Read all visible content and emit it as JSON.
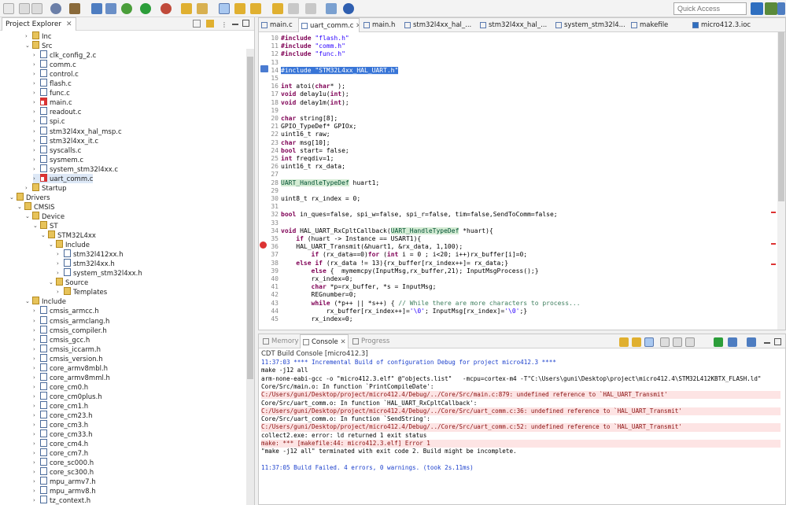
{
  "toolbar": {
    "quick_access_placeholder": "Quick Access",
    "colors": {
      "run": "#2c9e3a",
      "debug": "#4e7dc1",
      "build": "#6b6b6b",
      "warn": "#e0b030",
      "error": "#d33"
    }
  },
  "explorer": {
    "title": "Project Explorer",
    "close": "✕",
    "tree": [
      {
        "label": "Inc",
        "depth": 3,
        "kind": "folder",
        "tw": "›"
      },
      {
        "label": "Src",
        "depth": 3,
        "kind": "folder",
        "tw": "⌄"
      },
      {
        "label": "clk_config_2.c",
        "depth": 4,
        "kind": "c",
        "tw": "›"
      },
      {
        "label": "comm.c",
        "depth": 4,
        "kind": "c",
        "tw": "›"
      },
      {
        "label": "control.c",
        "depth": 4,
        "kind": "c",
        "tw": "›"
      },
      {
        "label": "flash.c",
        "depth": 4,
        "kind": "c",
        "tw": "›"
      },
      {
        "label": "func.c",
        "depth": 4,
        "kind": "c",
        "tw": "›"
      },
      {
        "label": "main.c",
        "depth": 4,
        "kind": "err",
        "tw": "›"
      },
      {
        "label": "readout.c",
        "depth": 4,
        "kind": "c",
        "tw": "›"
      },
      {
        "label": "spi.c",
        "depth": 4,
        "kind": "c",
        "tw": "›"
      },
      {
        "label": "stm32l4xx_hal_msp.c",
        "depth": 4,
        "kind": "c",
        "tw": "›"
      },
      {
        "label": "stm32l4xx_it.c",
        "depth": 4,
        "kind": "c",
        "tw": "›"
      },
      {
        "label": "syscalls.c",
        "depth": 4,
        "kind": "c",
        "tw": "›"
      },
      {
        "label": "sysmem.c",
        "depth": 4,
        "kind": "c",
        "tw": "›"
      },
      {
        "label": "system_stm32l4xx.c",
        "depth": 4,
        "kind": "c",
        "tw": "›"
      },
      {
        "label": "uart_comm.c",
        "depth": 4,
        "kind": "err",
        "tw": "›",
        "selected": true
      },
      {
        "label": "Startup",
        "depth": 3,
        "kind": "folder",
        "tw": "›"
      },
      {
        "label": "Drivers",
        "depth": 1,
        "kind": "folder",
        "tw": "⌄"
      },
      {
        "label": "CMSIS",
        "depth": 2,
        "kind": "folder",
        "tw": "⌄"
      },
      {
        "label": "Device",
        "depth": 3,
        "kind": "folder",
        "tw": "⌄"
      },
      {
        "label": "ST",
        "depth": 4,
        "kind": "folder",
        "tw": "⌄"
      },
      {
        "label": "STM32L4xx",
        "depth": 5,
        "kind": "folder",
        "tw": "⌄"
      },
      {
        "label": "Include",
        "depth": 6,
        "kind": "folder",
        "tw": "⌄"
      },
      {
        "label": "stm32l412xx.h",
        "depth": 7,
        "kind": "h",
        "tw": "›"
      },
      {
        "label": "stm32l4xx.h",
        "depth": 7,
        "kind": "h",
        "tw": "›"
      },
      {
        "label": "system_stm32l4xx.h",
        "depth": 7,
        "kind": "h",
        "tw": "›"
      },
      {
        "label": "Source",
        "depth": 6,
        "kind": "folder",
        "tw": "⌄"
      },
      {
        "label": "Templates",
        "depth": 7,
        "kind": "folder",
        "tw": "›"
      },
      {
        "label": "Include",
        "depth": 3,
        "kind": "folder",
        "tw": "⌄"
      },
      {
        "label": "cmsis_armcc.h",
        "depth": 4,
        "kind": "h",
        "tw": "›"
      },
      {
        "label": "cmsis_armclang.h",
        "depth": 4,
        "kind": "h",
        "tw": "›"
      },
      {
        "label": "cmsis_compiler.h",
        "depth": 4,
        "kind": "h",
        "tw": "›"
      },
      {
        "label": "cmsis_gcc.h",
        "depth": 4,
        "kind": "h",
        "tw": "›"
      },
      {
        "label": "cmsis_iccarm.h",
        "depth": 4,
        "kind": "h",
        "tw": "›"
      },
      {
        "label": "cmsis_version.h",
        "depth": 4,
        "kind": "h",
        "tw": "›"
      },
      {
        "label": "core_armv8mbl.h",
        "depth": 4,
        "kind": "h",
        "tw": "›"
      },
      {
        "label": "core_armv8mml.h",
        "depth": 4,
        "kind": "h",
        "tw": "›"
      },
      {
        "label": "core_cm0.h",
        "depth": 4,
        "kind": "h",
        "tw": "›"
      },
      {
        "label": "core_cm0plus.h",
        "depth": 4,
        "kind": "h",
        "tw": "›"
      },
      {
        "label": "core_cm1.h",
        "depth": 4,
        "kind": "h",
        "tw": "›"
      },
      {
        "label": "core_cm23.h",
        "depth": 4,
        "kind": "h",
        "tw": "›"
      },
      {
        "label": "core_cm3.h",
        "depth": 4,
        "kind": "h",
        "tw": "›"
      },
      {
        "label": "core_cm33.h",
        "depth": 4,
        "kind": "h",
        "tw": "›"
      },
      {
        "label": "core_cm4.h",
        "depth": 4,
        "kind": "h",
        "tw": "›"
      },
      {
        "label": "core_cm7.h",
        "depth": 4,
        "kind": "h",
        "tw": "›"
      },
      {
        "label": "core_sc000.h",
        "depth": 4,
        "kind": "h",
        "tw": "›"
      },
      {
        "label": "core_sc300.h",
        "depth": 4,
        "kind": "h",
        "tw": "›"
      },
      {
        "label": "mpu_armv7.h",
        "depth": 4,
        "kind": "h",
        "tw": "›"
      },
      {
        "label": "mpu_armv8.h",
        "depth": 4,
        "kind": "h",
        "tw": "›"
      },
      {
        "label": "tz_context.h",
        "depth": 4,
        "kind": "h",
        "tw": "›"
      }
    ]
  },
  "editor": {
    "tabs": [
      {
        "label": "main.c"
      },
      {
        "label": "uart_comm.c",
        "active": true,
        "close": "✕"
      },
      {
        "label": "main.h"
      },
      {
        "label": "stm32l4xx_hal_..."
      },
      {
        "label": "stm32l4xx_hal_..."
      },
      {
        "label": "system_stm32l4..."
      },
      {
        "label": "makefile"
      },
      {
        "label": "micro412.3.ioc"
      }
    ],
    "lines": [
      {
        "n": "10",
        "t": "#include \"flash.h\""
      },
      {
        "n": "11",
        "t": "#include \"comm.h\""
      },
      {
        "n": "12",
        "t": "#include \"func.h\""
      },
      {
        "n": "13",
        "t": ""
      },
      {
        "n": "14",
        "t": "#include \"STM32L4xx_HAL_UART.h\""
      },
      {
        "n": "15",
        "t": ""
      },
      {
        "n": "16",
        "t": "int atoi(char* );"
      },
      {
        "n": "17",
        "t": "void delay1u(int);"
      },
      {
        "n": "18",
        "t": "void delay1m(int);"
      },
      {
        "n": "19",
        "t": ""
      },
      {
        "n": "20",
        "t": "char string[8];"
      },
      {
        "n": "21",
        "t": "GPIO_TypeDef* GPIOx;"
      },
      {
        "n": "22",
        "t": "uint16_t raw;"
      },
      {
        "n": "23",
        "t": "char msg[10];"
      },
      {
        "n": "24",
        "t": "bool start= false;"
      },
      {
        "n": "25",
        "t": "int freqdiv=1;"
      },
      {
        "n": "26",
        "t": "uint16_t rx_data;"
      },
      {
        "n": "27",
        "t": ""
      },
      {
        "n": "28",
        "t": "UART_HandleTypeDef huart1;"
      },
      {
        "n": "29",
        "t": ""
      },
      {
        "n": "30",
        "t": "uint8_t rx_index = 0;"
      },
      {
        "n": "31",
        "t": ""
      },
      {
        "n": "32",
        "t": "bool in_ques=false, spi_w=false, spi_r=false, tim=false,SendToComm=false;"
      },
      {
        "n": "33",
        "t": ""
      },
      {
        "n": "34",
        "t": "void HAL_UART_RxCpltCallback(UART_HandleTypeDef *huart){"
      },
      {
        "n": "35",
        "t": "    if (huart -> Instance == USART1){"
      },
      {
        "n": "36",
        "t": "    HAL_UART_Transmit(&huart1, &rx_data, 1,100);"
      },
      {
        "n": "37",
        "t": "        if (rx_data==0)for (int i = 0 ; i<20; i++)rx_buffer[i]=0;"
      },
      {
        "n": "38",
        "t": "    else if (rx_data != 13){rx_buffer[rx_index++]= rx_data;}"
      },
      {
        "n": "39",
        "t": "        else {  mymemcpy(InputMsg,rx_buffer,21); InputMsgProcess();}"
      },
      {
        "n": "40",
        "t": "        rx_index=0;"
      },
      {
        "n": "41",
        "t": "        char *p=rx_buffer, *s = InputMsg;"
      },
      {
        "n": "42",
        "t": "        REGnumber=0;"
      },
      {
        "n": "43",
        "t": "        while (*p++ || *s++) { // While there are more characters to process..."
      },
      {
        "n": "44",
        "t": "            rx_buffer[rx_index++]='\\0'; InputMsg[rx_index]='\\0';}"
      },
      {
        "n": "45",
        "t": "        rx_index=0;"
      }
    ]
  },
  "console": {
    "tabs": [
      {
        "label": "Memory"
      },
      {
        "label": "Console",
        "active": true,
        "close": "✕"
      },
      {
        "label": "Progress"
      }
    ],
    "header": "CDT Build Console [micro412.3]",
    "lines": [
      {
        "t": "11:37:03 **** Incremental Build of configuration Debug for project micro412.3 ****",
        "k": "blue"
      },
      {
        "t": "make -j12 all",
        "k": ""
      },
      {
        "t": "arm-none-eabi-gcc -o \"micro412.3.elf\" @\"objects.list\"   -mcpu=cortex-m4 -T\"C:\\Users\\guni\\Desktop\\project\\micro412.4\\STM32L412KBTX_FLASH.ld\"",
        "k": ""
      },
      {
        "t": "Core/Src/main.o: In function `PrintCompileDate':",
        "k": ""
      },
      {
        "t": "C:/Users/guni/Desktop/project/micro412.4/Debug/../Core/Src/main.c:879: undefined reference to `HAL_UART_Transmit'",
        "k": "err"
      },
      {
        "t": "Core/Src/uart_comm.o: In function `HAL_UART_RxCpltCallback':",
        "k": ""
      },
      {
        "t": "C:/Users/guni/Desktop/project/micro412.4/Debug/../Core/Src/uart_comm.c:36: undefined reference to `HAL_UART_Transmit'",
        "k": "err"
      },
      {
        "t": "Core/Src/uart_comm.o: In function `SendString':",
        "k": ""
      },
      {
        "t": "C:/Users/guni/Desktop/project/micro412.4/Debug/../Core/Src/uart_comm.c:52: undefined reference to `HAL_UART_Transmit'",
        "k": "err"
      },
      {
        "t": "collect2.exe: error: ld returned 1 exit status",
        "k": ""
      },
      {
        "t": "make: *** [makefile:44: micro412.3.elf] Error 1",
        "k": "err"
      },
      {
        "t": "\"make -j12 all\" terminated with exit code 2. Build might be incomplete.",
        "k": ""
      },
      {
        "t": "",
        "k": ""
      },
      {
        "t": "11:37:05 Build Failed. 4 errors, 0 warnings. (took 2s.11ms)",
        "k": "blue"
      }
    ]
  }
}
